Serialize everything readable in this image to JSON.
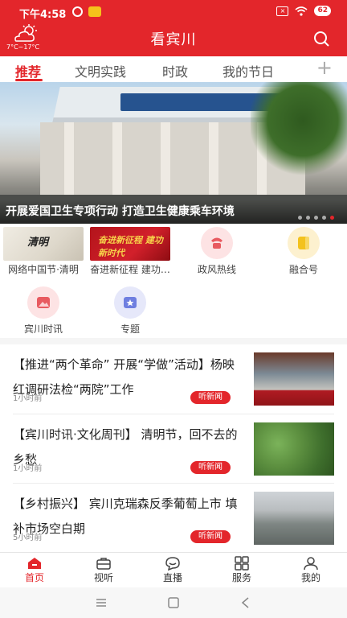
{
  "status_bar": {
    "time": "下午4:58",
    "battery": "62"
  },
  "header": {
    "title": "看宾川",
    "weather_temp": "7°C~17°C"
  },
  "tabs": [
    {
      "label": "推荐"
    },
    {
      "label": "文明实践"
    },
    {
      "label": "时政"
    },
    {
      "label": "我的节日"
    }
  ],
  "tabs_add": "+",
  "banner": {
    "caption": "开展爱国卫生专项行动 打造卫生健康乘车环境",
    "dots_total": 5,
    "dot_active": 5
  },
  "shortcuts": [
    {
      "label": "网络中国节·清明",
      "thumb_text": "清明"
    },
    {
      "label": "奋进新征程 建功…",
      "thumb_text": "奋进新征程 建功新时代"
    },
    {
      "label": "政风热线",
      "icon": "phone-icon",
      "color": "#e85a60"
    },
    {
      "label": "融合号",
      "icon": "tag-icon",
      "color": "#f3c21d"
    },
    {
      "label": "宾川时讯",
      "icon": "image-icon",
      "color": "#e85a60"
    },
    {
      "label": "专题",
      "icon": "star-icon",
      "color": "#6f7fe0"
    }
  ],
  "news": [
    {
      "title": "【推进“两个革命” 开展“学做”活动】杨映红调研法检“两院”工作",
      "time": "1小时前",
      "listen": "听新闻"
    },
    {
      "title": "【宾川时讯·文化周刊】 清明节，回不去的乡愁",
      "time": "1小时前",
      "listen": "听新闻"
    },
    {
      "title": "【乡村振兴】 宾川克瑞森反季葡萄上市  填补市场空白期",
      "time": "5小时前",
      "listen": "听新闻"
    }
  ],
  "bottom_nav": [
    {
      "label": "首页",
      "icon": "home-icon",
      "active": true
    },
    {
      "label": "视听",
      "icon": "briefcase-icon"
    },
    {
      "label": "直播",
      "icon": "live-icon"
    },
    {
      "label": "服务",
      "icon": "grid-icon"
    },
    {
      "label": "我的",
      "icon": "user-icon"
    }
  ],
  "colors": {
    "brand": "#e3262b"
  }
}
